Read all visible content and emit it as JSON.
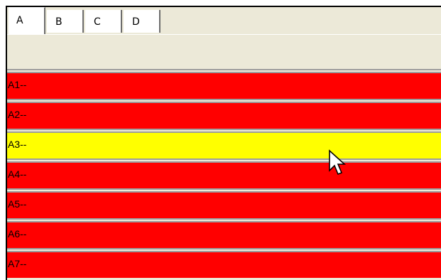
{
  "tabs": [
    {
      "label": "A",
      "active": true
    },
    {
      "label": "B",
      "active": false
    },
    {
      "label": "C",
      "active": false
    },
    {
      "label": "D",
      "active": false
    }
  ],
  "rows": [
    {
      "label": "A1--",
      "color": "#ff0000"
    },
    {
      "label": "A2--",
      "color": "#ff0000"
    },
    {
      "label": "A3--",
      "color": "#ffff00"
    },
    {
      "label": "A4--",
      "color": "#ff0000"
    },
    {
      "label": "A5--",
      "color": "#ff0000"
    },
    {
      "label": "A6--",
      "color": "#ff0000"
    },
    {
      "label": "A7--",
      "color": "#ff0000"
    }
  ],
  "colors": {
    "row_default": "#ff0000",
    "row_hover": "#ffff00",
    "panel_bg": "#ece9d8"
  },
  "cursor": {
    "icon": "arrow-pointer-icon"
  }
}
